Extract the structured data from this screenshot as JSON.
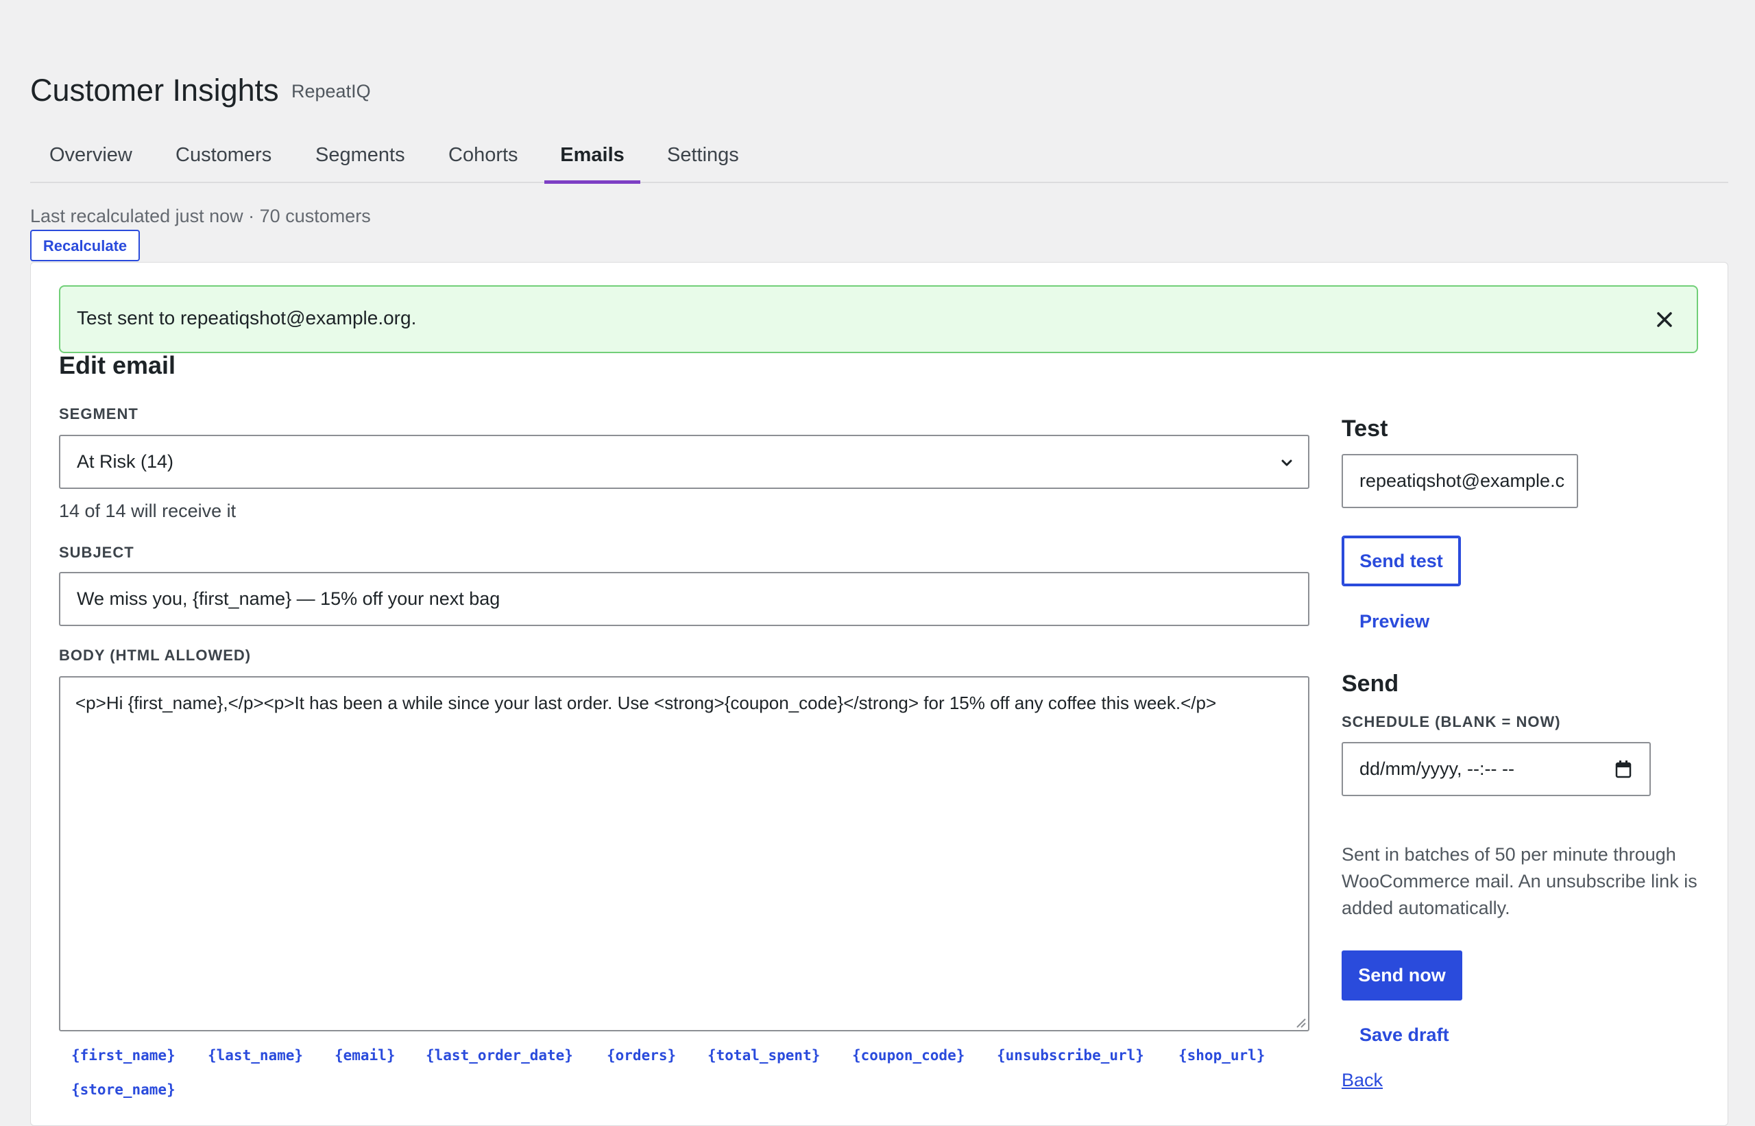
{
  "header": {
    "title": "Customer Insights",
    "brand": "RepeatIQ"
  },
  "tabs": [
    {
      "label": "Overview"
    },
    {
      "label": "Customers"
    },
    {
      "label": "Segments"
    },
    {
      "label": "Cohorts"
    },
    {
      "label": "Emails",
      "active": true
    },
    {
      "label": "Settings"
    }
  ],
  "status": {
    "text": "Last recalculated just now · 70 customers",
    "recalc_label": "Recalculate"
  },
  "notice": {
    "text": "Test sent to repeatiqshot@example.org.",
    "close_icon": "close-icon"
  },
  "editor": {
    "heading": "Edit email",
    "segment": {
      "label": "SEGMENT",
      "value": "At Risk (14)",
      "hint": "14 of 14 will receive it"
    },
    "subject": {
      "label": "SUBJECT",
      "value": "We miss you, {first_name} — 15% off your next bag"
    },
    "body": {
      "label": "BODY (HTML ALLOWED)",
      "value": "<p>Hi {first_name},</p><p>It has been a while since your last order. Use <strong>{coupon_code}</strong> for 15% off any coffee this week.</p>"
    },
    "merge_tags": [
      "{first_name}",
      "{last_name}",
      "{email}",
      "{last_order_date}",
      "{orders}",
      "{total_spent}",
      "{coupon_code}",
      "{unsubscribe_url}",
      "{shop_url}",
      "{store_name}"
    ]
  },
  "sidebar": {
    "test_heading": "Test",
    "test_email": "repeatiqshot@example.c",
    "send_test_label": "Send test",
    "preview_label": "Preview",
    "send_heading": "Send",
    "schedule_label": "SCHEDULE (BLANK = NOW)",
    "schedule_placeholder": "dd/mm/yyyy, --:-- --",
    "note": "Sent in batches of 50 per minute through WooCommerce mail. An unsubscribe link is added automatically.",
    "send_now_label": "Send now",
    "save_draft_label": "Save draft",
    "back_label": "Back"
  },
  "colors": {
    "accent": "#2a4bdc",
    "tab_active": "#7d3fc4",
    "notice_bg": "#e8fbe9",
    "notice_border": "#71cf78"
  }
}
